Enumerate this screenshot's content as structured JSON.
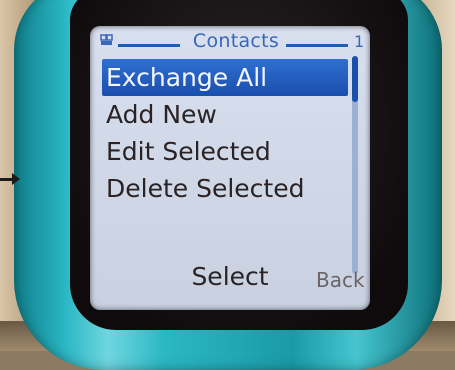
{
  "screen": {
    "title": "Contacts",
    "page_number": "1",
    "status_icon": "signal-icon"
  },
  "menu": {
    "items": [
      {
        "label": "Exchange All",
        "selected": true
      },
      {
        "label": "Add New",
        "selected": false
      },
      {
        "label": "Edit Selected",
        "selected": false
      },
      {
        "label": "Delete Selected",
        "selected": false
      }
    ]
  },
  "softkeys": {
    "left": "Select",
    "right": "Back"
  },
  "colors": {
    "highlight": "#1a4fae",
    "title": "#3a67b8",
    "phone_body": "#2bb7c4"
  }
}
